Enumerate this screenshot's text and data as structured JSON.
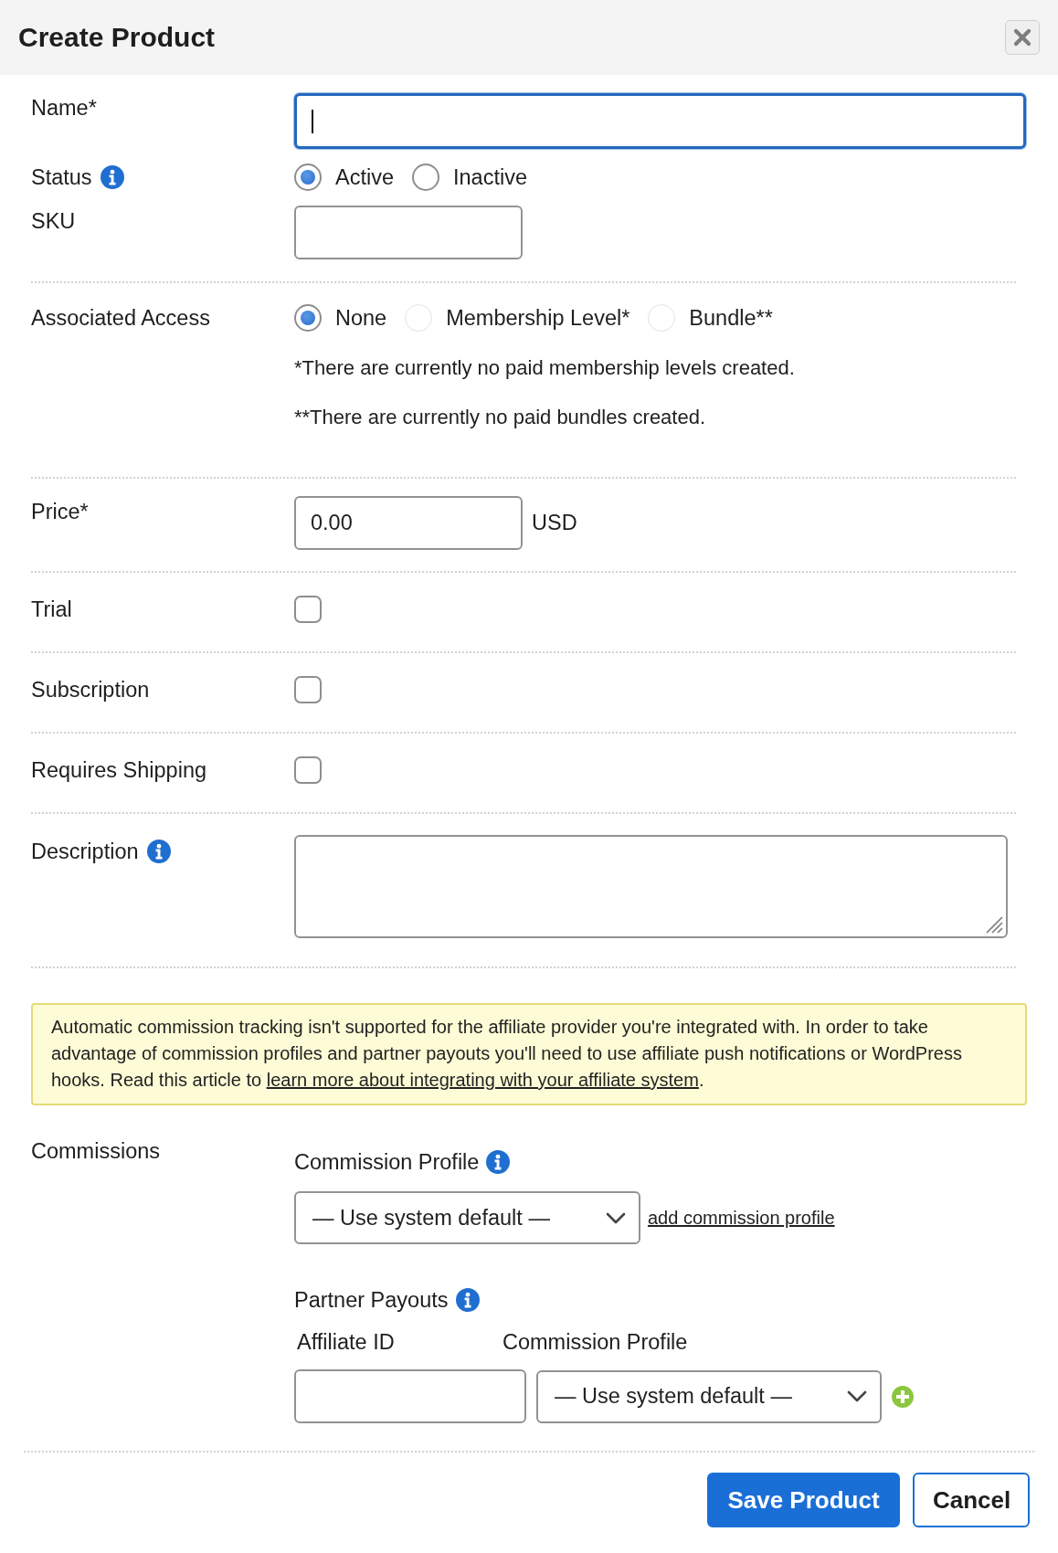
{
  "dialog": {
    "title": "Create Product"
  },
  "sections": [
    {
      "rows": [
        {
          "kind": "text-long",
          "label": "Name*",
          "focused": true
        },
        {
          "kind": "radio",
          "label": "Status",
          "info": true,
          "options": [
            {
              "label": "Active",
              "selected": true
            },
            {
              "label": "Inactive",
              "selected": false
            }
          ]
        },
        {
          "kind": "text-short",
          "label": "SKU",
          "focused": false
        }
      ]
    },
    {
      "rows": [
        {
          "kind": "radio",
          "label": "Associated Access",
          "options": [
            {
              "label": "None",
              "selected": true,
              "disabled": false
            },
            {
              "label": "Membership Level*",
              "selected": false,
              "disabled": true
            },
            {
              "label": "Bundle**",
              "selected": false,
              "disabled": true
            }
          ],
          "notes": [
            "*There are currently no paid membership levels created.",
            "**There are currently no paid bundles created."
          ]
        }
      ]
    },
    {
      "rows": [
        {
          "kind": "text-short",
          "label": "Price*",
          "value": "0.00",
          "suffix": "USD",
          "focused": false
        }
      ]
    },
    {
      "rows": [
        {
          "kind": "checkbox",
          "label": "Trial",
          "checked": false
        }
      ]
    },
    {
      "rows": [
        {
          "kind": "checkbox",
          "label": "Subscription",
          "checked": false
        }
      ]
    },
    {
      "rows": [
        {
          "kind": "checkbox",
          "label": "Requires Shipping",
          "checked": false
        }
      ]
    },
    {
      "rows": [
        {
          "kind": "textarea",
          "label": "Description",
          "info": true
        }
      ]
    }
  ],
  "notice": {
    "text": "Automatic commission tracking isn't supported for the affiliate provider you're integrated with. In order to take advantage of commission profiles and partner payouts you'll need to use affiliate push notifications or WordPress hooks. Read this article to ",
    "link": "learn more about integrating with your affiliate system",
    "text_end": "."
  },
  "commissions": {
    "label": "Commissions",
    "profile": {
      "heading": "Commission Profile",
      "info": true,
      "select": "— Use system default —",
      "link": "add commission profile"
    },
    "payouts": {
      "heading": "Partner Payouts",
      "info": true,
      "columns": [
        "Affiliate ID",
        "Commission Profile"
      ],
      "select": "— Use system default —"
    }
  },
  "buttons": [
    {
      "label": "Save Product",
      "kind": "primary"
    },
    {
      "label": "Cancel",
      "kind": "secondary"
    }
  ]
}
